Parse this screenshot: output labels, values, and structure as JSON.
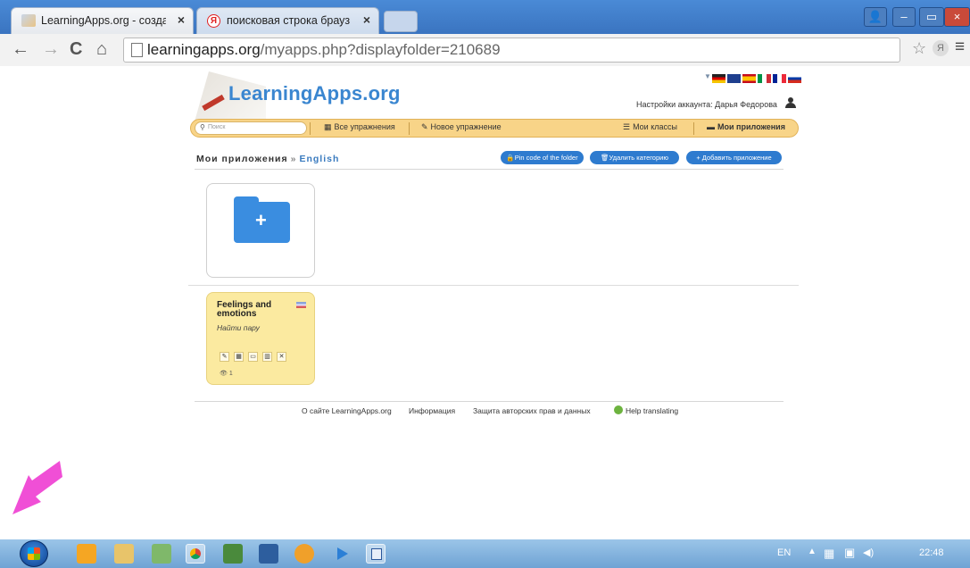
{
  "browser": {
    "tabs": [
      {
        "title": "LearningApps.org - создан",
        "close": "×"
      },
      {
        "title": "поисковая строка брауз",
        "favicon_letter": "Я",
        "close": "×"
      }
    ],
    "url_host": "learningapps.org",
    "url_path": "/myapps.php?displayfolder=210689",
    "nav_icons": {
      "back": "←",
      "forward": "→",
      "reload": "C",
      "home": "⌂"
    },
    "window_buttons": {
      "user": "👤",
      "minimize": "–",
      "maximize": "▭",
      "close": "×"
    },
    "right_icons": {
      "zoom": "⊕",
      "star": "☆",
      "yandex": "Я",
      "menu": "≡"
    }
  },
  "site": {
    "logo": "LearningApps.org",
    "account_label": "Настройки аккаунта: Дарья Федорова",
    "search_placeholder": "Поиск",
    "nav": {
      "all_exercises": "Все упражнения",
      "new_exercise": "Новое упражнение",
      "my_classes": "Мои классы",
      "my_apps": "Мои приложения"
    },
    "breadcrumb": {
      "root": "Мои приложения",
      "separator": "»",
      "current": "English"
    },
    "buttons": {
      "pin_code": "Pin code of the folder",
      "delete_category": "Удалить категорию",
      "add_app": "+ Добавить приложение"
    },
    "app_card": {
      "title": "Feelings and emotions",
      "type": "Найти пару",
      "tools": [
        "✎",
        "▦",
        "▭",
        "▥",
        "✕"
      ],
      "views": "👁 1"
    },
    "footer": {
      "about": "О сайте LearningApps.org",
      "info": "Информация",
      "privacy": "Защита авторских прав и данных",
      "help": "Help translating"
    }
  },
  "taskbar": {
    "language": "EN",
    "time": "22:48",
    "tray_up": "▲"
  },
  "colors": {
    "navbar": "#f8d488",
    "accent_blue": "#2e7bcf",
    "app_card": "#fbeaa0",
    "arrow": "#f04fd6"
  }
}
